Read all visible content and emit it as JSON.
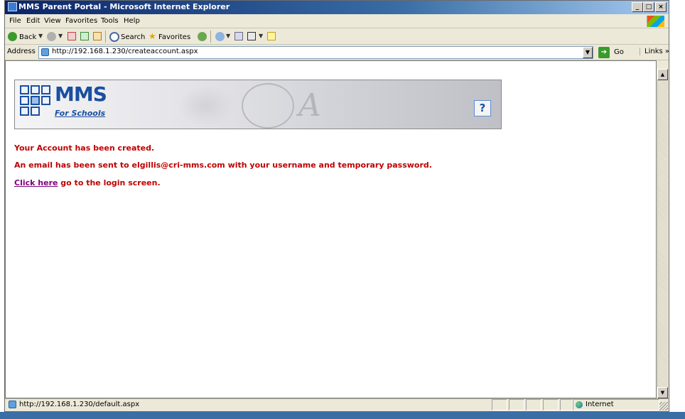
{
  "window": {
    "title": "MMS Parent Portal - Microsoft Internet Explorer"
  },
  "caption_buttons": {
    "minimize": "_",
    "maximize": "□",
    "close": "×"
  },
  "menu": {
    "items": [
      "File",
      "Edit",
      "View",
      "Favorites",
      "Tools",
      "Help"
    ]
  },
  "toolbar": {
    "back_label": "Back",
    "search_label": "Search",
    "favorites_label": "Favorites"
  },
  "address_bar": {
    "label": "Address",
    "url": "http://192.168.1.230/createaccount.aspx",
    "go_label": "Go",
    "links_label": "Links »"
  },
  "banner": {
    "logo_text": "MMS",
    "logo_subtitle": "For Schools",
    "help_label": "?"
  },
  "messages": {
    "created": "Your Account has been created.",
    "email_sent": "An email has been sent to elgillis@cri-mms.com with your username and temporary password.",
    "login_link": "Click here",
    "login_suffix": " go to the login screen."
  },
  "status_bar": {
    "text": "http://192.168.1.230/default.aspx",
    "zone": "Internet"
  },
  "colors": {
    "message_red": "#c00000",
    "link_visited": "#800080",
    "logo_blue": "#1a4fa0",
    "titlebar_blue": "#0a246a"
  }
}
